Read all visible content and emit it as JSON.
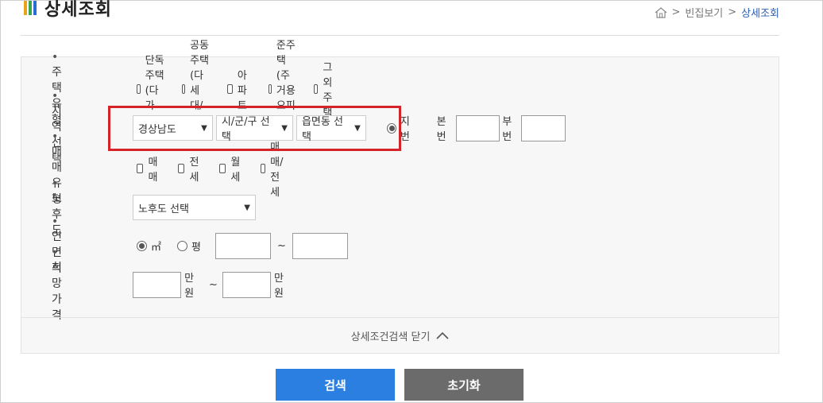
{
  "header": {
    "title": "상세조회"
  },
  "breadcrumb": {
    "items": [
      "빈집보기",
      "상세조회"
    ]
  },
  "filters": {
    "housing_type": {
      "label": "주택유형",
      "options": [
        "단독주택(다가구)",
        "공동주택(다세대/연립)",
        "아파트",
        "준주택(주거용 오피스텔)",
        "그 외 주택"
      ]
    },
    "region": {
      "label": "지역선택",
      "province": "경상남도",
      "city": "시/군/구 선택",
      "town": "읍면동 선택",
      "radio": "지번",
      "main_no_label": "본번",
      "sub_no_label": "부번"
    },
    "trade_type": {
      "label": "매매유형",
      "options": [
        "매매",
        "전세",
        "월세",
        "매매/전세"
      ]
    },
    "aging": {
      "label": "노후도",
      "select": "노후도 선택"
    },
    "area": {
      "label": "연면적",
      "units": [
        "㎡",
        "평"
      ],
      "tilde": "~"
    },
    "price": {
      "label": "희망가격",
      "unit1": "만원",
      "tilde": "~",
      "unit2": "만원"
    }
  },
  "toggle": {
    "label": "상세조건검색 닫기"
  },
  "buttons": {
    "search": "검색",
    "reset": "초기화"
  },
  "colors": {
    "search_button": "#2b7fe0",
    "reset_button": "#6b6b6b",
    "highlight_border": "#d6232a"
  }
}
